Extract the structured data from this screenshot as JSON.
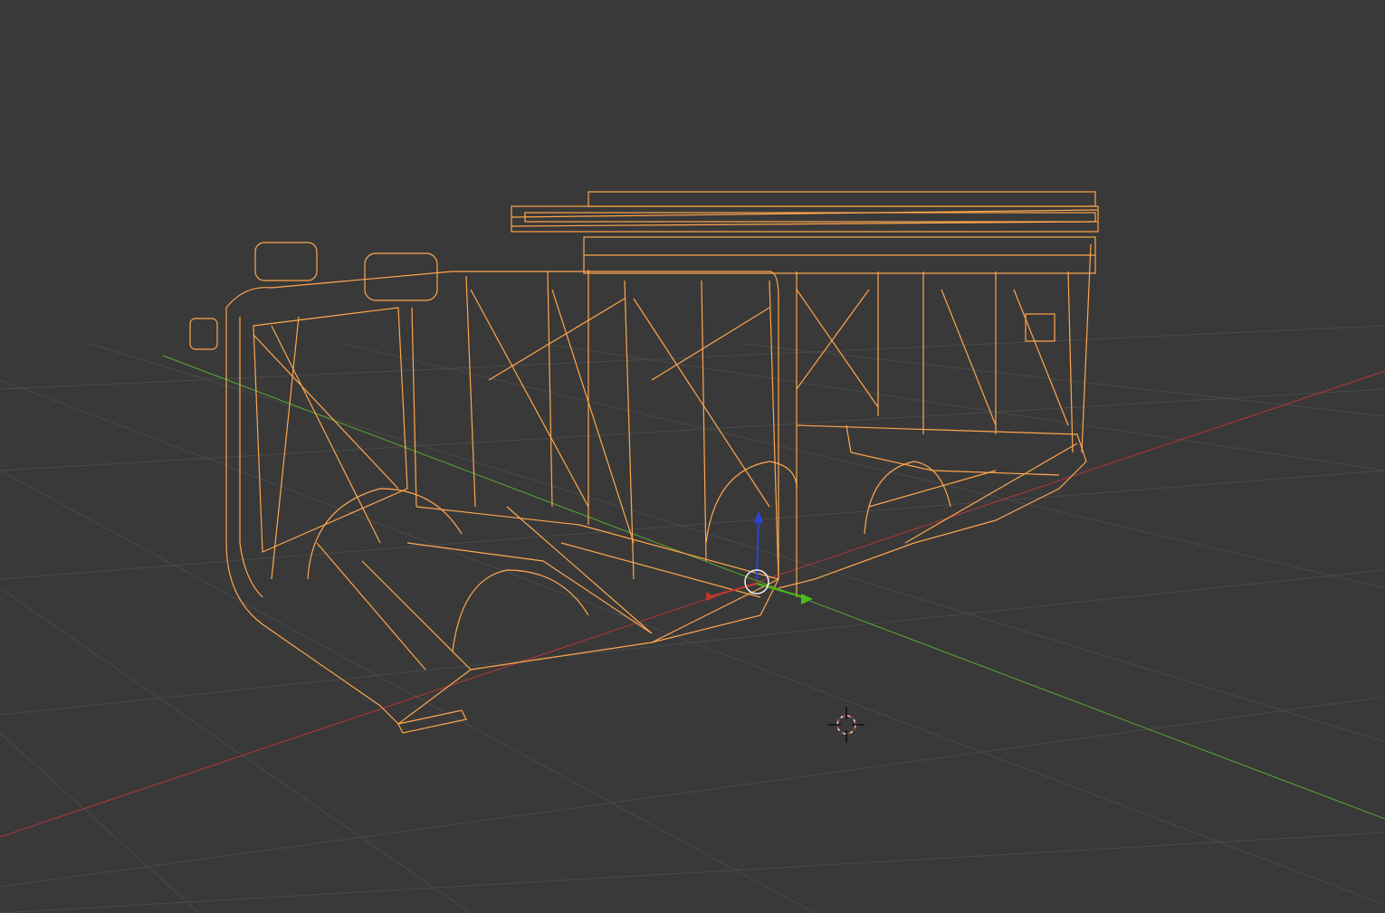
{
  "viewport": {
    "mode": "wireframe",
    "object": "truck-body",
    "background_color": "#393939",
    "grid_color": "#4a4a4a",
    "wire_color": "#ffa64d",
    "axis_x_color": "#b3383a",
    "axis_y_color": "#5aa832",
    "gizmo_z_color": "#2a45d6",
    "cursor_color": "#e0e0e0"
  }
}
